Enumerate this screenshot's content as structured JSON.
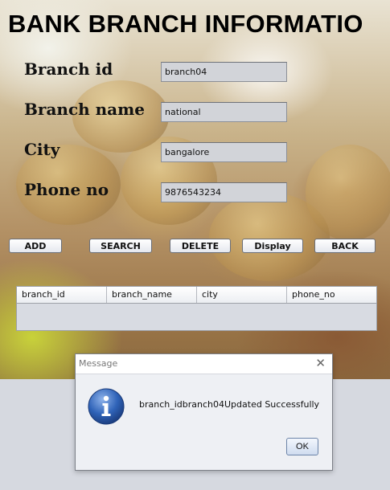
{
  "form": {
    "title": "BANK BRANCH INFORMATIO",
    "fields": {
      "branch_id": {
        "label": "Branch id",
        "value": "branch04"
      },
      "branch_name": {
        "label": "Branch name",
        "value": "national"
      },
      "city": {
        "label": "City",
        "value": "bangalore"
      },
      "phone_no": {
        "label": "Phone no",
        "value": "9876543234"
      }
    },
    "buttons": {
      "add": "ADD",
      "search": "SEARCH",
      "delete": "DELETE",
      "display": "Display",
      "back": "BACK"
    }
  },
  "table": {
    "columns": [
      "branch_id",
      "branch_name",
      "city",
      "phone_no"
    ]
  },
  "dialog": {
    "title": "Message",
    "close_glyph": "✕",
    "message": "branch_idbranch04Updated Successfully",
    "ok_label": "OK",
    "icon": "information-icon"
  },
  "colors": {
    "dialog_icon_blue": "#2f63b8",
    "field_background": "#d2d4d9"
  }
}
